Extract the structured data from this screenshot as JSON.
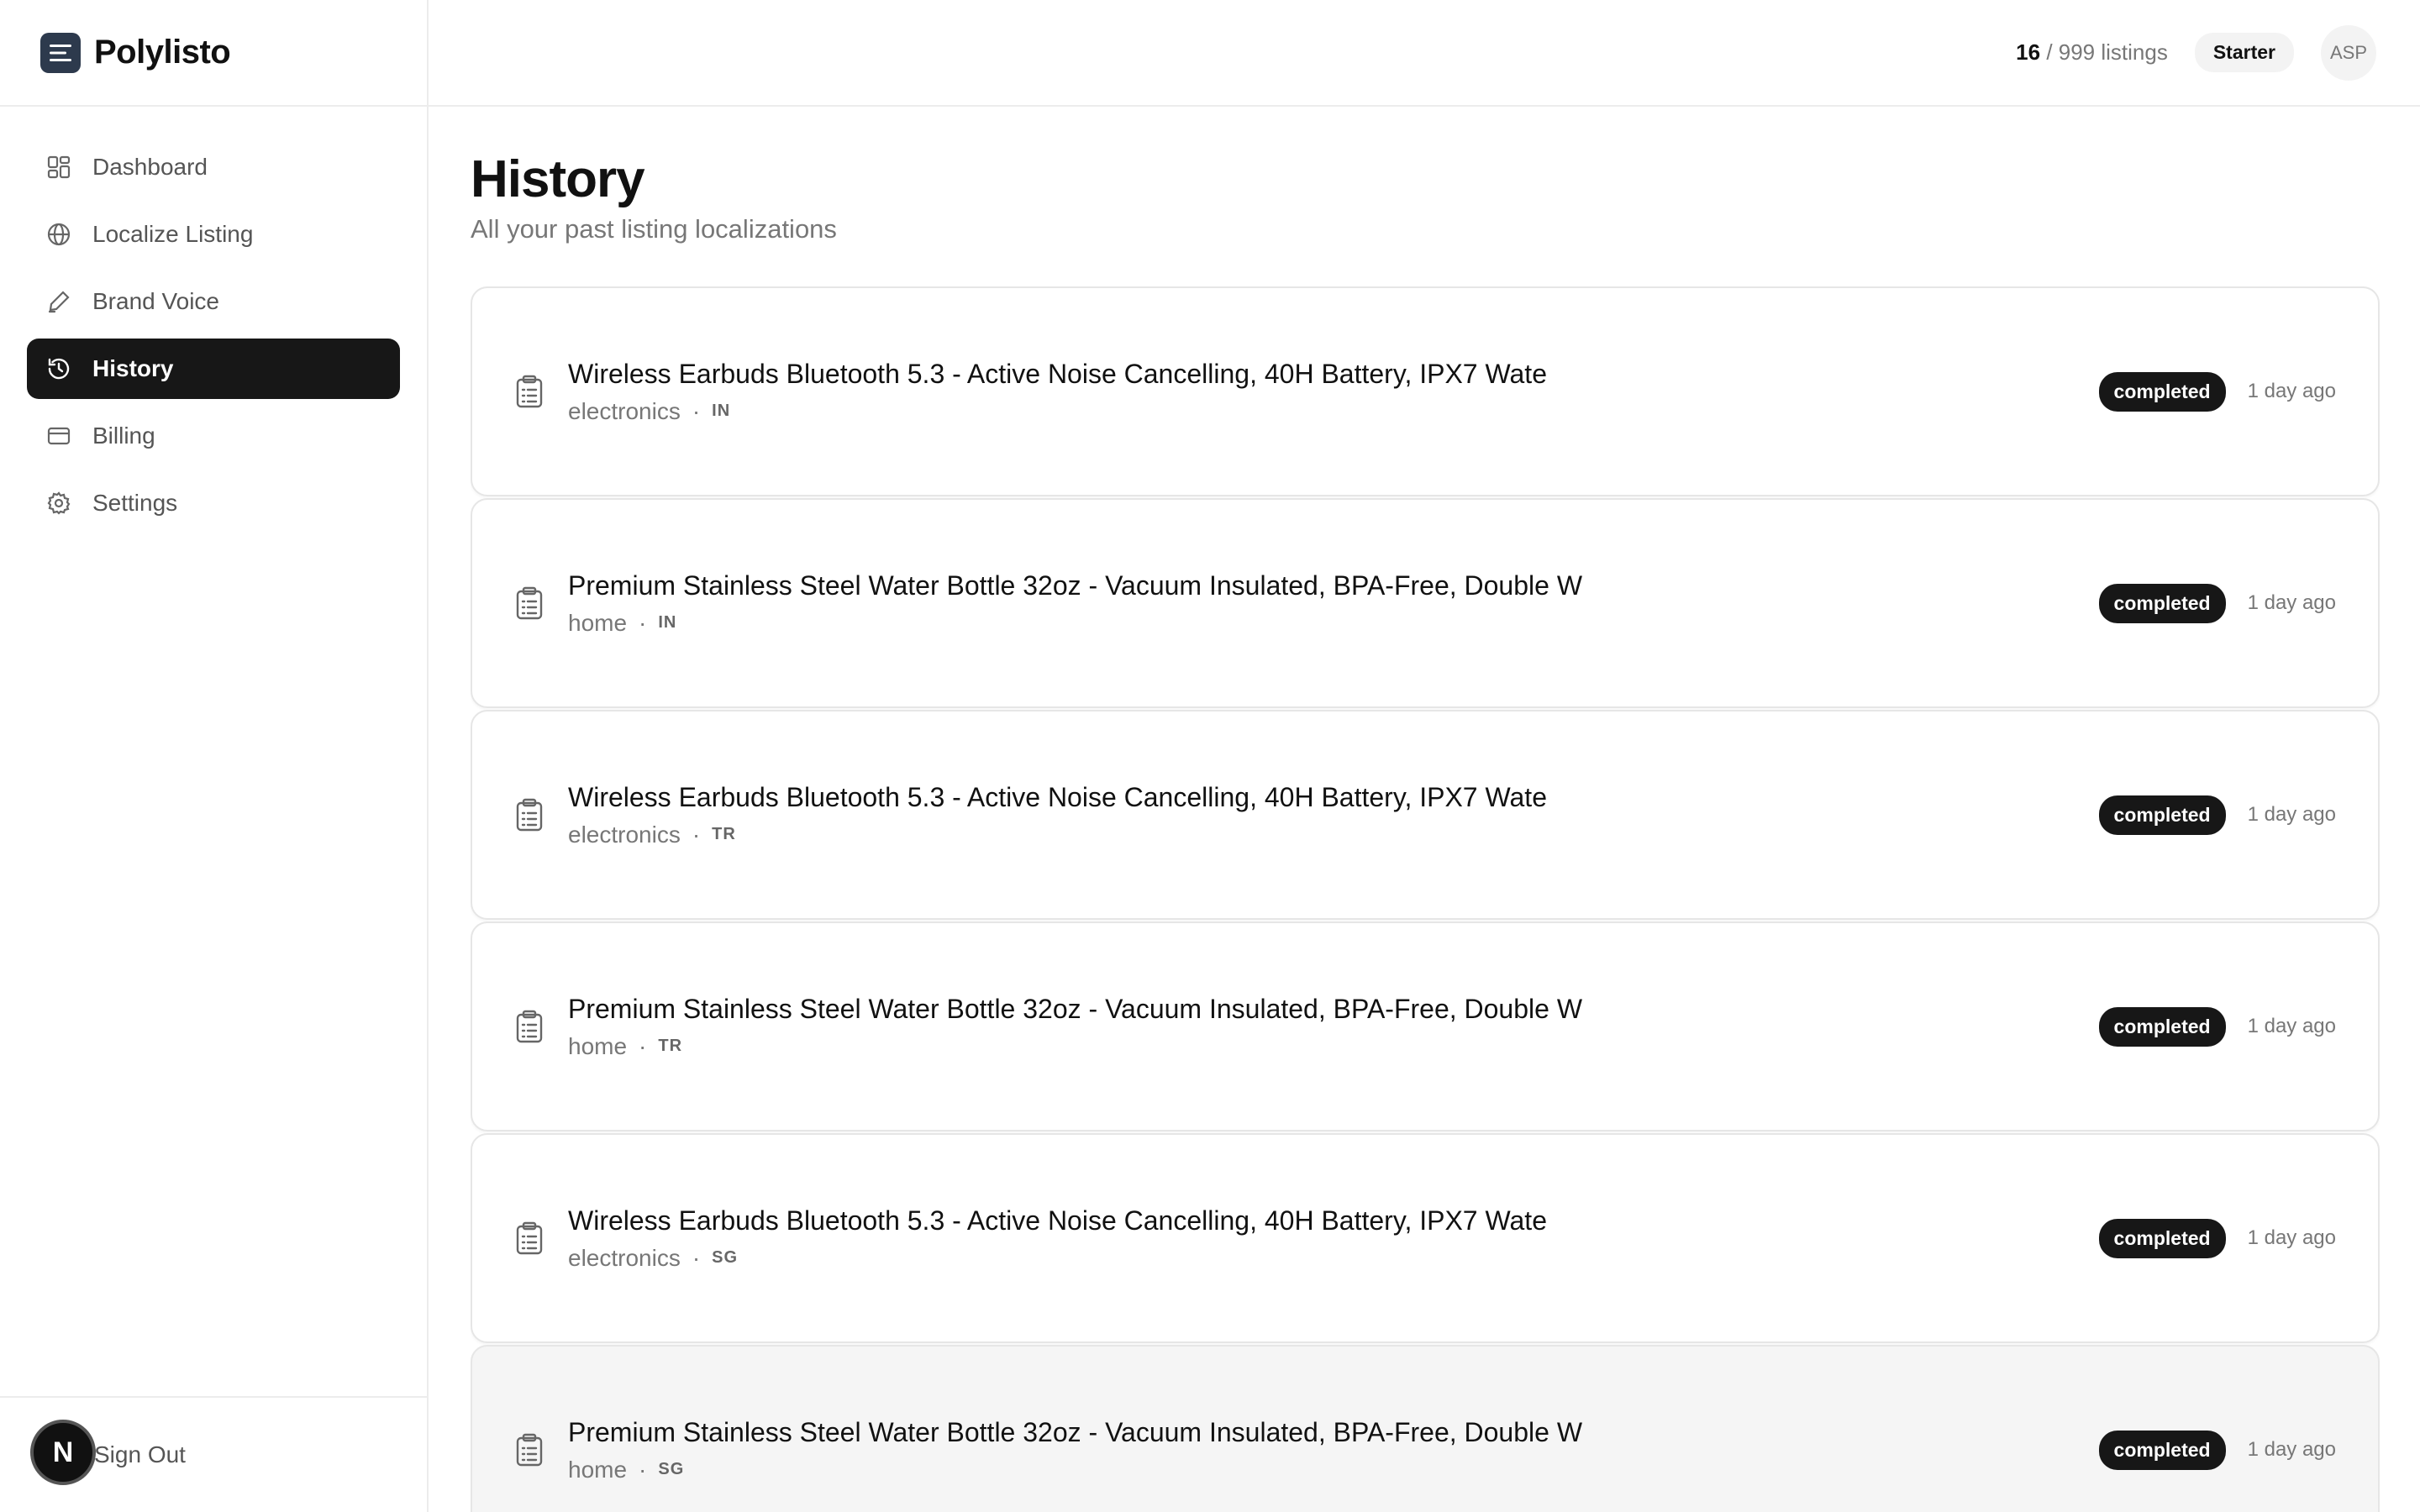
{
  "app": {
    "name": "Polylisto"
  },
  "sidebar": {
    "items": [
      {
        "label": "Dashboard",
        "icon": "dashboard-grid-icon",
        "active": false
      },
      {
        "label": "Localize Listing",
        "icon": "globe-icon",
        "active": false
      },
      {
        "label": "Brand Voice",
        "icon": "pen-icon",
        "active": false
      },
      {
        "label": "History",
        "icon": "history-icon",
        "active": true
      },
      {
        "label": "Billing",
        "icon": "credit-card-icon",
        "active": false
      },
      {
        "label": "Settings",
        "icon": "gear-icon",
        "active": false
      }
    ],
    "footer": {
      "sign_out_label": "Sign Out",
      "badge_letter": "N"
    }
  },
  "header": {
    "usage_used": "16",
    "usage_rest": "/ 999 listings",
    "plan": "Starter",
    "avatar_initials": "ASP"
  },
  "page": {
    "title": "History",
    "subtitle": "All your past listing localizations"
  },
  "history": [
    {
      "title": "Wireless Earbuds Bluetooth 5.3 - Active Noise Cancelling, 40H Battery, IPX7 Wate",
      "category": "electronics",
      "market": "IN",
      "status": "completed",
      "time": "1 day ago"
    },
    {
      "title": "Premium Stainless Steel Water Bottle 32oz - Vacuum Insulated, BPA-Free, Double W",
      "category": "home",
      "market": "IN",
      "status": "completed",
      "time": "1 day ago"
    },
    {
      "title": "Wireless Earbuds Bluetooth 5.3 - Active Noise Cancelling, 40H Battery, IPX7 Wate",
      "category": "electronics",
      "market": "TR",
      "status": "completed",
      "time": "1 day ago"
    },
    {
      "title": "Premium Stainless Steel Water Bottle 32oz - Vacuum Insulated, BPA-Free, Double W",
      "category": "home",
      "market": "TR",
      "status": "completed",
      "time": "1 day ago"
    },
    {
      "title": "Wireless Earbuds Bluetooth 5.3 - Active Noise Cancelling, 40H Battery, IPX7 Wate",
      "category": "electronics",
      "market": "SG",
      "status": "completed",
      "time": "1 day ago"
    },
    {
      "title": "Premium Stainless Steel Water Bottle 32oz - Vacuum Insulated, BPA-Free, Double W",
      "category": "home",
      "market": "SG",
      "status": "completed",
      "time": "1 day ago"
    }
  ],
  "colors": {
    "accent": "#171717",
    "logo_bg": "#2d3a4d",
    "muted_text": "#777777",
    "border": "#e6e6e6"
  }
}
